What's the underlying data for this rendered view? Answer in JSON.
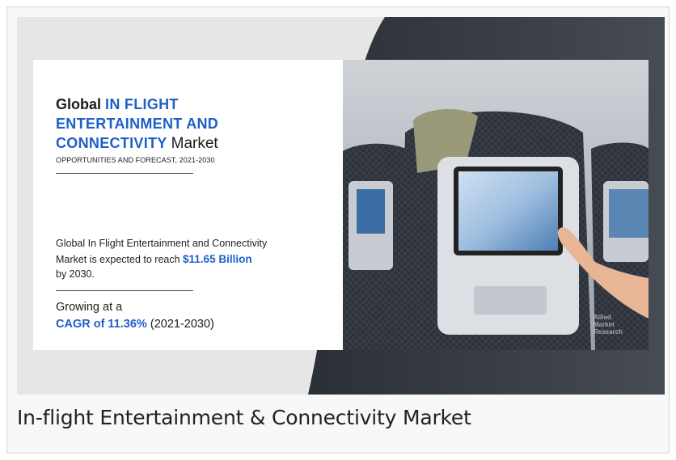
{
  "infographic": {
    "title_prefix": "Global",
    "title_highlight_1": "IN FLIGHT",
    "title_highlight_2": "ENTERTAINMENT AND",
    "title_highlight_3": "CONNECTIVITY",
    "title_suffix": "Market",
    "subtitle": "OPPORTUNITIES AND FORECAST, 2021-2030",
    "body_line_1": "Global In Flight Entertainment and Connectivity",
    "body_line_2a": "Market is expected to reach",
    "body_value": "$11.65 Billion",
    "body_line_3": "by 2030.",
    "growing_label": "Growing at a",
    "cagr_highlight": "CAGR of 11.36%",
    "cagr_period": "(2021-2030)",
    "watermark_1": "Allied",
    "watermark_2": "Market",
    "watermark_3": "Research"
  },
  "caption": "In-flight Entertainment & Connectivity Market",
  "colors": {
    "accent_blue": "#1f5fc9",
    "frame_gray": "#e6e6e6"
  }
}
